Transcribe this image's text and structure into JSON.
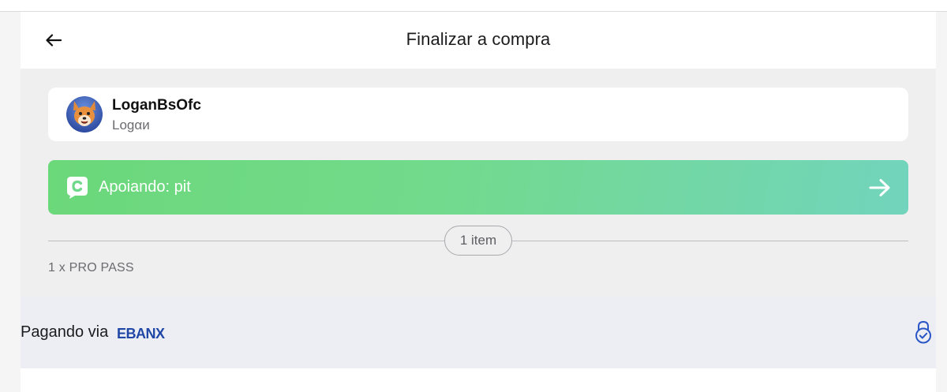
{
  "header": {
    "title": "Finalizar a compra"
  },
  "creator": {
    "name": "LoganBsOfc",
    "subtitle": "Lᴏgαи"
  },
  "support": {
    "label": "Apoiando: pit"
  },
  "order": {
    "items_count": "1 item",
    "line_item": "1 x PRO PASS"
  },
  "payment": {
    "label": "Pagando via",
    "provider": "EBANX"
  },
  "colors": {
    "banner_start": "#6bd87a",
    "banner_end": "#72d4bc",
    "ebanx_blue": "#2047a6",
    "lock_blue": "#2a56c6"
  },
  "icons": [
    "back-arrow-icon",
    "fox-avatar",
    "support-c-logo-icon",
    "right-arrow-icon",
    "ebanx-logo",
    "lock-check-icon"
  ]
}
